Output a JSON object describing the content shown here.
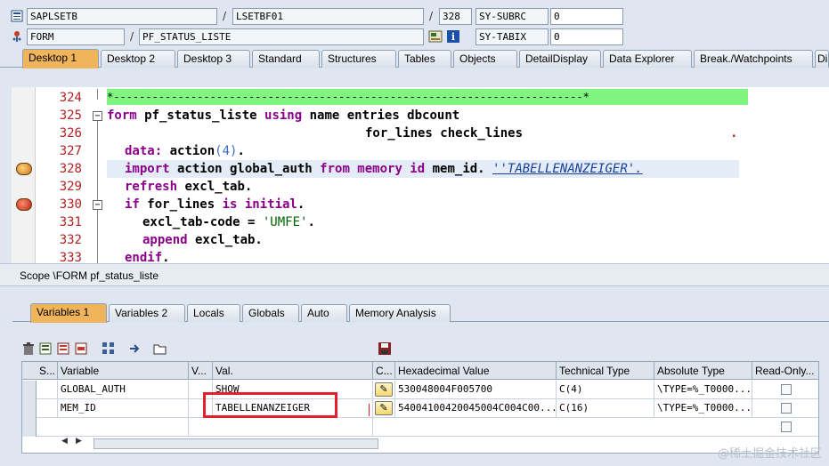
{
  "header": {
    "program": "SAPLSETB",
    "include": "LSETBF01",
    "line": "328",
    "sysubrc_label": "SY-SUBRC",
    "sysubrc_value": "0",
    "event_type": "FORM",
    "event_name": "PF_STATUS_LISTE",
    "sytabix_label": "SY-TABIX",
    "sytabix_value": "0",
    "slash": "/"
  },
  "desktop_tabs": [
    "Desktop 1",
    "Desktop 2",
    "Desktop 3",
    "Standard",
    "Structures",
    "Tables",
    "Objects",
    "DetailDisplay",
    "Data Explorer",
    "Break./Watchpoints",
    "Di"
  ],
  "code": {
    "line_numbers": [
      "324",
      "325",
      "326",
      "327",
      "328",
      "329",
      "330",
      "331",
      "332",
      "333"
    ],
    "comment_line": "*-------------------------------------------------------------------------*",
    "l325_kw1": "form",
    "l325_a": " pf_status_liste ",
    "l325_kw2": "using",
    "l325_b": " name entries dbcount",
    "l326": "for_lines check_lines",
    "l326_dot": ".",
    "l327_kw": "data:",
    "l327_a": " action",
    "l327_paren_open": "(",
    "l327_num": "4",
    "l327_paren_close": ")",
    "l327_dot": ".",
    "l328_kw1": "import",
    "l328_a": " action global_auth ",
    "l328_kw2": "from",
    "l328_kw3": " memory id",
    "l328_b": " mem_id. ",
    "l328_str": "''TABELLENANZEIGER'.",
    "l329_kw": "refresh",
    "l329_a": " excl_tab.",
    "l330_kw1": "if",
    "l330_a": " for_lines ",
    "l330_kw2": "is initial",
    "l330_dot": ".",
    "l331_a": "excl_tab-code = ",
    "l331_str": "'UMFE'",
    "l331_dot": ".",
    "l332_kw": "append",
    "l332_a": " excl_tab.",
    "l333_kw": "endif",
    "l333_dot": "."
  },
  "scope": "Scope \\FORM pf_status_liste",
  "var_tabs": [
    "Variables 1",
    "Variables 2",
    "Locals",
    "Globals",
    "Auto",
    "Memory Analysis"
  ],
  "table": {
    "headers": [
      "S...",
      "Variable",
      "V...",
      "Val.",
      "C...",
      "Hexadecimal Value",
      "Technical Type",
      "Absolute Type",
      "Read-Only..."
    ],
    "rows": [
      {
        "variable": "GLOBAL_AUTH",
        "value": "SHOW",
        "hex": "530048004F005700",
        "tech": "C(4)",
        "abs": "\\TYPE=%_T0000..."
      },
      {
        "variable": "MEM_ID",
        "value": "TABELLENANZEIGER",
        "hex": "54004100420045004C004C00...",
        "tech": "C(16)",
        "abs": "\\TYPE=%_T0000..."
      }
    ]
  },
  "watermark": "@稀土掘金技术社区",
  "colors": {
    "active_tab": "#f0b45a",
    "comment_bg": "#7ff47f",
    "highlight_box": "#e3202b",
    "keyword": "#8b008b"
  }
}
